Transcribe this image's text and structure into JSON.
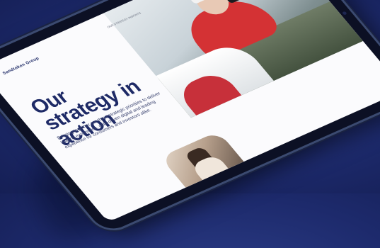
{
  "tablet_page": {
    "brand": "Sandtoken Group",
    "nav": "OUR STRATEGY   INSIGHTS",
    "title": "Our strategy in action",
    "body": "Bringing together our three strategic priorities to deliver leading experience, data-driven digital and leading experience for consumers and investors alike."
  },
  "colors": {
    "background": "#1d2a6c",
    "title": "#1e2a66",
    "bezel": "#0c1024",
    "jacket": "#d43234"
  }
}
